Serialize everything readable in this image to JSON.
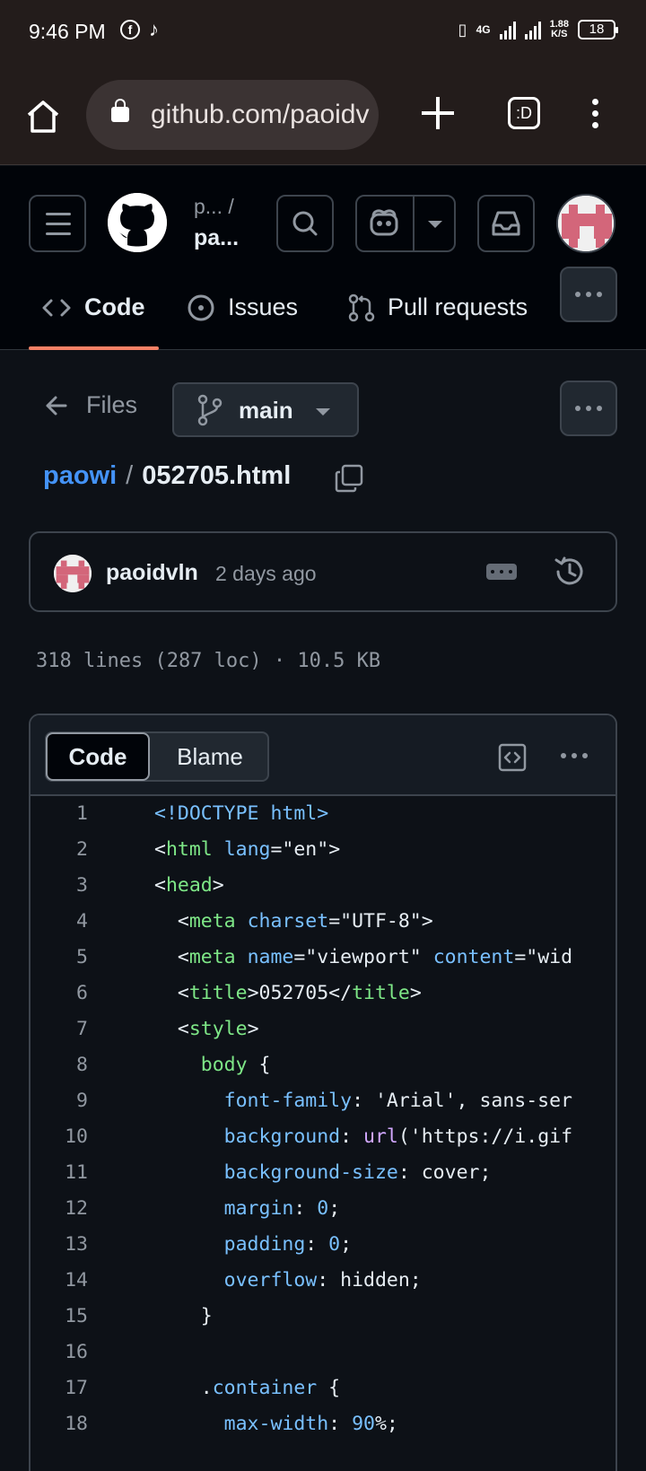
{
  "status_bar": {
    "time": "9:46 PM",
    "network": "4G",
    "speed_value": "1.88",
    "speed_unit": "K/S",
    "battery": "18"
  },
  "browser": {
    "url": "github.com/paoidv",
    "tabs_label": ":D"
  },
  "repo": {
    "owner_truncated": "p...",
    "owner_sep": "/",
    "name_truncated": "pa..."
  },
  "tabs": [
    {
      "label": "Code"
    },
    {
      "label": "Issues"
    },
    {
      "label": "Pull requests"
    }
  ],
  "file_nav": {
    "back_label": "Files",
    "branch": "main"
  },
  "breadcrumb": {
    "repo": "paowi",
    "sep": "/",
    "file": "052705.html"
  },
  "commit": {
    "author": "paoidvln",
    "time": "2 days ago"
  },
  "file_info": "318 lines (287 loc) · 10.5 KB",
  "viewer": {
    "code_tab": "Code",
    "blame_tab": "Blame"
  },
  "code_lines": [
    {
      "n": "1",
      "indent": "",
      "tokens": [
        [
          "doc",
          "<!DOCTYPE html>"
        ]
      ]
    },
    {
      "n": "2",
      "indent": "",
      "tokens": [
        [
          "txt",
          "<"
        ],
        [
          "tag",
          "html"
        ],
        [
          "txt",
          " "
        ],
        [
          "attr",
          "lang"
        ],
        [
          "txt",
          "=\"en\">"
        ]
      ]
    },
    {
      "n": "3",
      "indent": "",
      "tokens": [
        [
          "txt",
          "<"
        ],
        [
          "tag",
          "head"
        ],
        [
          "txt",
          ">"
        ]
      ]
    },
    {
      "n": "4",
      "indent": "  ",
      "tokens": [
        [
          "txt",
          "<"
        ],
        [
          "tag",
          "meta"
        ],
        [
          "txt",
          " "
        ],
        [
          "attr",
          "charset"
        ],
        [
          "txt",
          "=\"UTF-8\">"
        ]
      ]
    },
    {
      "n": "5",
      "indent": "  ",
      "tokens": [
        [
          "txt",
          "<"
        ],
        [
          "tag",
          "meta"
        ],
        [
          "txt",
          " "
        ],
        [
          "attr",
          "name"
        ],
        [
          "txt",
          "=\"viewport\" "
        ],
        [
          "attr",
          "content"
        ],
        [
          "txt",
          "=\"wid"
        ]
      ]
    },
    {
      "n": "6",
      "indent": "  ",
      "tokens": [
        [
          "txt",
          "<"
        ],
        [
          "tag",
          "title"
        ],
        [
          "txt",
          ">052705</"
        ],
        [
          "tag",
          "title"
        ],
        [
          "txt",
          ">"
        ]
      ]
    },
    {
      "n": "7",
      "indent": "  ",
      "tokens": [
        [
          "txt",
          "<"
        ],
        [
          "tag",
          "style"
        ],
        [
          "txt",
          ">"
        ]
      ]
    },
    {
      "n": "8",
      "indent": "    ",
      "tokens": [
        [
          "sel",
          "body"
        ],
        [
          "txt",
          " {"
        ]
      ]
    },
    {
      "n": "9",
      "indent": "      ",
      "tokens": [
        [
          "prop",
          "font-family"
        ],
        [
          "txt",
          ": 'Arial', sans-ser"
        ]
      ]
    },
    {
      "n": "10",
      "indent": "      ",
      "tokens": [
        [
          "prop",
          "background"
        ],
        [
          "txt",
          ": "
        ],
        [
          "fn",
          "url"
        ],
        [
          "txt",
          "('https://i.gif"
        ]
      ]
    },
    {
      "n": "11",
      "indent": "      ",
      "tokens": [
        [
          "prop",
          "background-size"
        ],
        [
          "txt",
          ": cover;"
        ]
      ]
    },
    {
      "n": "12",
      "indent": "      ",
      "tokens": [
        [
          "prop",
          "margin"
        ],
        [
          "txt",
          ": "
        ],
        [
          "num",
          "0"
        ],
        [
          "txt",
          ";"
        ]
      ]
    },
    {
      "n": "13",
      "indent": "      ",
      "tokens": [
        [
          "prop",
          "padding"
        ],
        [
          "txt",
          ": "
        ],
        [
          "num",
          "0"
        ],
        [
          "txt",
          ";"
        ]
      ]
    },
    {
      "n": "14",
      "indent": "      ",
      "tokens": [
        [
          "prop",
          "overflow"
        ],
        [
          "txt",
          ": hidden;"
        ]
      ]
    },
    {
      "n": "15",
      "indent": "    ",
      "tokens": [
        [
          "txt",
          "}"
        ]
      ]
    },
    {
      "n": "16",
      "indent": "",
      "tokens": []
    },
    {
      "n": "17",
      "indent": "    ",
      "tokens": [
        [
          "txt",
          "."
        ],
        [
          "cls",
          "container"
        ],
        [
          "txt",
          " {"
        ]
      ]
    },
    {
      "n": "18",
      "indent": "      ",
      "tokens": [
        [
          "prop",
          "max-width"
        ],
        [
          "txt",
          ": "
        ],
        [
          "num",
          "90"
        ],
        [
          "txt",
          "%;"
        ]
      ]
    }
  ]
}
